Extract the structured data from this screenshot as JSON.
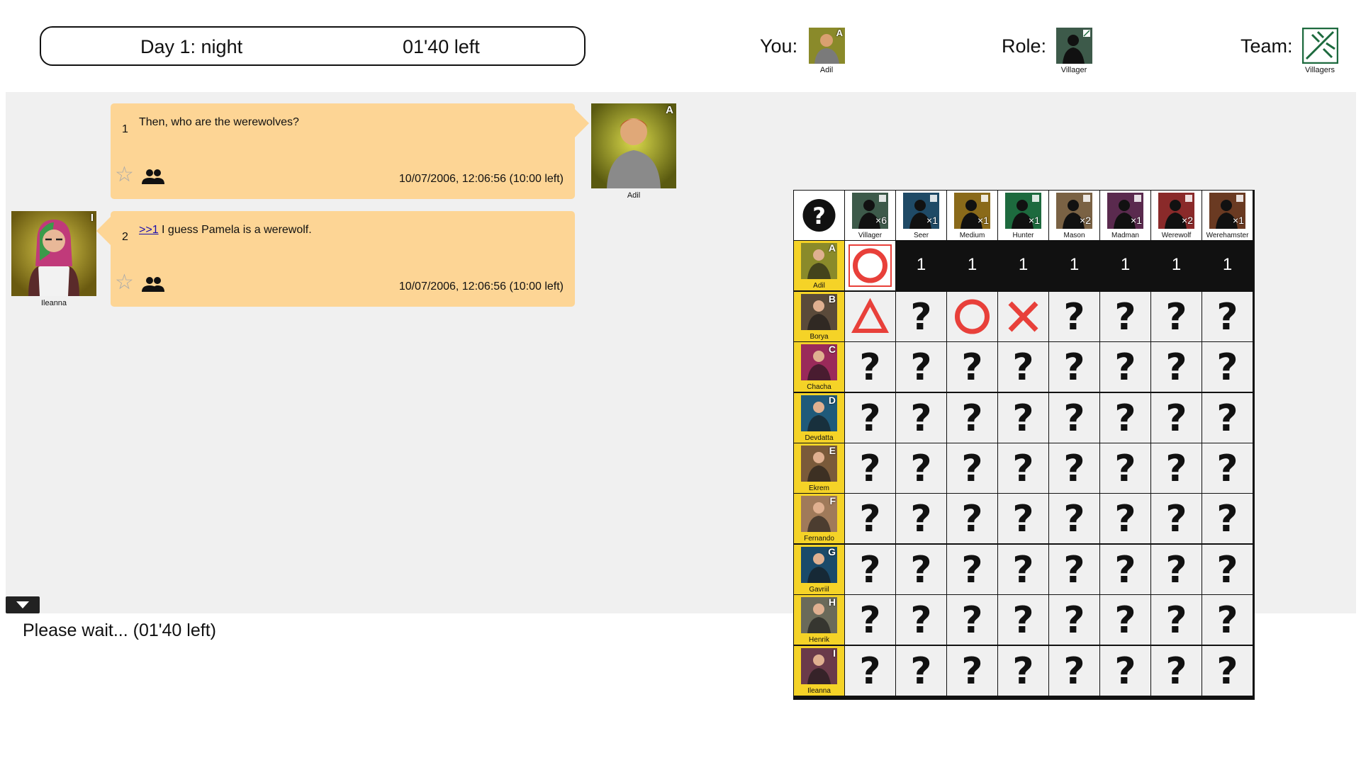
{
  "header": {
    "day_label": "Day 1: night",
    "time_left": "01'40 left",
    "you_label": "You:",
    "you_name": "Adil",
    "you_letter": "A",
    "role_label": "Role:",
    "role_name": "Villager",
    "team_label": "Team:",
    "team_name": "Villagers"
  },
  "chat": {
    "messages": [
      {
        "number": "1",
        "text": "Then, who are the werewolves?",
        "link": "",
        "timestamp": "10/07/2006, 12:06:56 (10:00 left)",
        "author": "Adil",
        "author_letter": "A"
      },
      {
        "number": "2",
        "link": ">>1",
        "text": " I guess Pamela is a werewolf.",
        "timestamp": "10/07/2006, 12:06:56 (10:00 left)",
        "author": "Ileanna",
        "author_letter": "I"
      }
    ]
  },
  "grid": {
    "corner_symbol": "?",
    "roles": [
      {
        "name": "Villager",
        "count": "×6",
        "color": "#3d5a4a"
      },
      {
        "name": "Seer",
        "count": "×1",
        "color": "#1f4a66"
      },
      {
        "name": "Medium",
        "count": "×1",
        "color": "#8a6a1a"
      },
      {
        "name": "Hunter",
        "count": "×1",
        "color": "#1d6a3e"
      },
      {
        "name": "Mason",
        "count": "×2",
        "color": "#7a6244"
      },
      {
        "name": "Madman",
        "count": "×1",
        "color": "#5a2a4e"
      },
      {
        "name": "Werewolf",
        "count": "×2",
        "color": "#8a2a2a"
      },
      {
        "name": "Werehamster",
        "count": "×1",
        "color": "#6a3a22"
      }
    ],
    "players": [
      {
        "name": "Adil",
        "letter": "A",
        "color": "#8a8a2a"
      },
      {
        "name": "Borya",
        "letter": "B",
        "color": "#5a4a3a"
      },
      {
        "name": "Chacha",
        "letter": "C",
        "color": "#9a2a5a"
      },
      {
        "name": "Devdatta",
        "letter": "D",
        "color": "#1f5a7a"
      },
      {
        "name": "Ekrem",
        "letter": "E",
        "color": "#7a5a3a"
      },
      {
        "name": "Fernando",
        "letter": "F",
        "color": "#a07a5a"
      },
      {
        "name": "Gavriil",
        "letter": "G",
        "color": "#1a4a6a"
      },
      {
        "name": "Henrik",
        "letter": "H",
        "color": "#6a6a5a"
      },
      {
        "name": "Ileanna",
        "letter": "I",
        "color": "#6a3a4a"
      }
    ],
    "self_row_values": [
      "1",
      "1",
      "1",
      "1",
      "1",
      "1",
      "1"
    ],
    "unknown_symbol": "?",
    "borya_marks": [
      "triangle",
      "?",
      "circle",
      "cross",
      "?",
      "?",
      "?",
      "?"
    ]
  },
  "status_text": "Please wait... (01'40 left)",
  "colors": {
    "bubble": "#fdd595",
    "player_cell": "#f5d327",
    "mark_red": "#e8403a",
    "team_green": "#1d6a3e"
  }
}
